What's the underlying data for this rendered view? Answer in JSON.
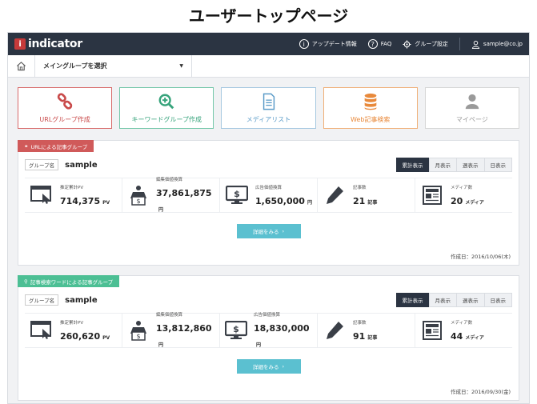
{
  "page_heading": "ユーザートップページ",
  "app": {
    "logo_mark": "i",
    "logo_text": "indicator"
  },
  "topbar": {
    "update_info": "アップデート情報",
    "faq": "FAQ",
    "group_settings": "グループ設定",
    "user_email": "sample@co.jp"
  },
  "selectbar": {
    "placeholder": "メイングループを選択",
    "caret": "▼"
  },
  "actions": [
    {
      "label": "URLグループ作成",
      "icon": "link-icon"
    },
    {
      "label": "キーワードグループ作成",
      "icon": "zoom-plus-icon"
    },
    {
      "label": "メディアリスト",
      "icon": "document-list-icon"
    },
    {
      "label": "Web記事検索",
      "icon": "database-icon"
    },
    {
      "label": "マイページ",
      "icon": "user-icon"
    }
  ],
  "panels": [
    {
      "badge": "URLによる記事グループ",
      "group_tag": "グループ名",
      "group_name": "sample",
      "tabs": [
        "累計表示",
        "月表示",
        "週表示",
        "日表示"
      ],
      "stats": [
        {
          "label": "推定累計PV",
          "value": "714,375",
          "unit": "PV"
        },
        {
          "label": "編集価値換算",
          "value": "37,861,875",
          "unit": "円"
        },
        {
          "label": "広告価値換算",
          "value": "1,650,000",
          "unit": "円"
        },
        {
          "label": "記事数",
          "value": "21",
          "unit": "記事"
        },
        {
          "label": "メディア数",
          "value": "20",
          "unit": "メディア"
        }
      ],
      "detail_button": "詳細をみる",
      "created": "作成日：2016/10/06(木)"
    },
    {
      "badge": "記事検索ワードによる記事グループ",
      "group_tag": "グループ名",
      "group_name": "sample",
      "tabs": [
        "累計表示",
        "月表示",
        "週表示",
        "日表示"
      ],
      "stats": [
        {
          "label": "推定累計PV",
          "value": "260,620",
          "unit": "PV"
        },
        {
          "label": "編集価値換算",
          "value": "13,812,860",
          "unit": "円"
        },
        {
          "label": "広告価値換算",
          "value": "18,830,000",
          "unit": "円"
        },
        {
          "label": "記事数",
          "value": "91",
          "unit": "記事"
        },
        {
          "label": "メディア数",
          "value": "44",
          "unit": "メディア"
        }
      ],
      "detail_button": "詳細をみる",
      "created": "作成日：2016/09/30(金)"
    }
  ],
  "colors": {
    "topbar": "#2b3442",
    "accent_teal": "#5bc0d0",
    "badge_red": "#d05a5a",
    "badge_green": "#4cbf94"
  }
}
